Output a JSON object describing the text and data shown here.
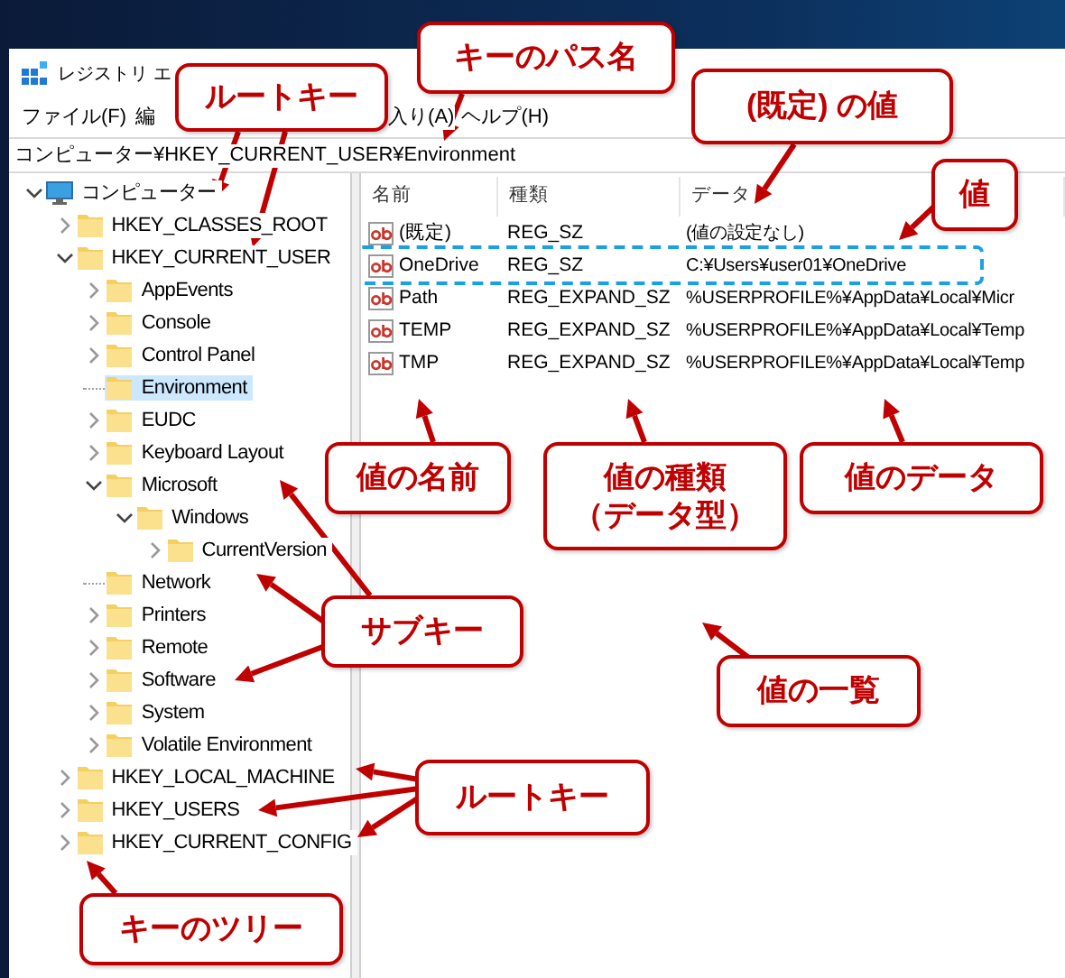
{
  "window": {
    "title": "レジストリ エ"
  },
  "menu": [
    {
      "label": "ファイル(F)"
    },
    {
      "label": "編"
    },
    {
      "label": "入り(A)"
    },
    {
      "label": "ヘルプ(H)"
    }
  ],
  "address": "コンピューター¥HKEY_CURRENT_USER¥Environment",
  "tree": [
    {
      "label": "コンピューター",
      "kind": "computer",
      "expanded": true,
      "selected": false,
      "children": [
        {
          "label": "HKEY_CLASSES_ROOT",
          "kind": "key",
          "expanded": false,
          "selected": false
        },
        {
          "label": "HKEY_CURRENT_USER",
          "kind": "key",
          "expanded": true,
          "selected": false,
          "children": [
            {
              "label": "AppEvents",
              "kind": "key",
              "expanded": false,
              "selected": false
            },
            {
              "label": "Console",
              "kind": "key",
              "expanded": false,
              "selected": false
            },
            {
              "label": "Control Panel",
              "kind": "key",
              "expanded": false,
              "selected": false
            },
            {
              "label": "Environment",
              "kind": "leaf",
              "expanded": false,
              "selected": true
            },
            {
              "label": "EUDC",
              "kind": "key",
              "expanded": false,
              "selected": false
            },
            {
              "label": "Keyboard Layout",
              "kind": "key",
              "expanded": false,
              "selected": false
            },
            {
              "label": "Microsoft",
              "kind": "key",
              "expanded": true,
              "selected": false,
              "children": [
                {
                  "label": "Windows",
                  "kind": "key",
                  "expanded": true,
                  "selected": false,
                  "children": [
                    {
                      "label": "CurrentVersion",
                      "kind": "key",
                      "expanded": false,
                      "selected": false
                    }
                  ]
                }
              ]
            },
            {
              "label": "Network",
              "kind": "leaf",
              "expanded": false,
              "selected": false
            },
            {
              "label": "Printers",
              "kind": "key",
              "expanded": false,
              "selected": false
            },
            {
              "label": "Remote",
              "kind": "key",
              "expanded": false,
              "selected": false
            },
            {
              "label": "Software",
              "kind": "key",
              "expanded": false,
              "selected": false
            },
            {
              "label": "System",
              "kind": "key",
              "expanded": false,
              "selected": false
            },
            {
              "label": "Volatile Environment",
              "kind": "key",
              "expanded": false,
              "selected": false
            }
          ]
        },
        {
          "label": "HKEY_LOCAL_MACHINE",
          "kind": "key",
          "expanded": false,
          "selected": false
        },
        {
          "label": "HKEY_USERS",
          "kind": "key",
          "expanded": false,
          "selected": false
        },
        {
          "label": "HKEY_CURRENT_CONFIG",
          "kind": "key",
          "expanded": false,
          "selected": false
        }
      ]
    }
  ],
  "values": {
    "columns": [
      {
        "label": "名前"
      },
      {
        "label": "種類"
      },
      {
        "label": "データ"
      }
    ],
    "rows": [
      {
        "name": "(既定)",
        "type": "REG_SZ",
        "data": "(値の設定なし)",
        "highlighted": false
      },
      {
        "name": "OneDrive",
        "type": "REG_SZ",
        "data": "C:¥Users¥user01¥OneDrive",
        "highlighted": true
      },
      {
        "name": "Path",
        "type": "REG_EXPAND_SZ",
        "data": "%USERPROFILE%¥AppData¥Local¥Micr",
        "highlighted": false
      },
      {
        "name": "TEMP",
        "type": "REG_EXPAND_SZ",
        "data": "%USERPROFILE%¥AppData¥Local¥Temp",
        "highlighted": false
      },
      {
        "name": "TMP",
        "type": "REG_EXPAND_SZ",
        "data": "%USERPROFILE%¥AppData¥Local¥Temp",
        "highlighted": false
      }
    ]
  },
  "callouts": [
    {
      "lines": [
        "ルートキー"
      ]
    },
    {
      "lines": [
        "キーのパス名"
      ]
    },
    {
      "lines": [
        "(既定) の値"
      ]
    },
    {
      "lines": [
        "値"
      ]
    },
    {
      "lines": [
        "値の名前"
      ]
    },
    {
      "lines": [
        "値の種類",
        "（データ型）"
      ]
    },
    {
      "lines": [
        "値のデータ"
      ]
    },
    {
      "lines": [
        "サブキー"
      ]
    },
    {
      "lines": [
        "値の一覧"
      ]
    },
    {
      "lines": [
        "ルートキー"
      ]
    },
    {
      "lines": [
        "キーのツリー"
      ]
    }
  ]
}
